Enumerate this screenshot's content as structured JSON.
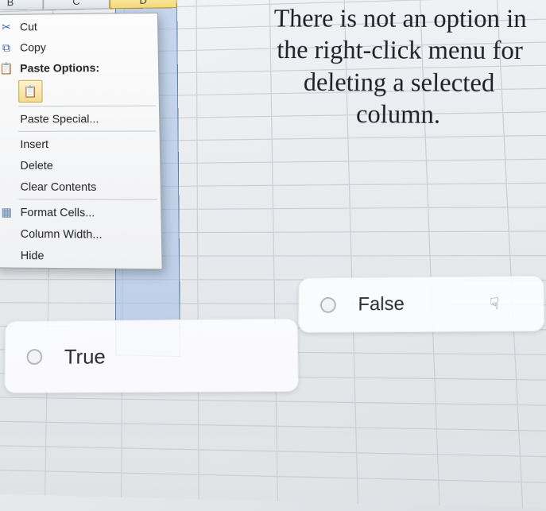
{
  "columns": {
    "B": "B",
    "C": "C",
    "D": "D"
  },
  "context_menu": {
    "cut": "Cut",
    "copy": "Copy",
    "paste_options": "Paste Options:",
    "paste_special": "Paste Special...",
    "insert": "Insert",
    "delete": "Delete",
    "clear_contents": "Clear Contents",
    "format_cells": "Format Cells...",
    "column_width": "Column Width...",
    "hide": "Hide"
  },
  "question_text": "There is not an option in the right-click menu for deleting a selected column.",
  "answers": {
    "true": "True",
    "false": "False"
  }
}
